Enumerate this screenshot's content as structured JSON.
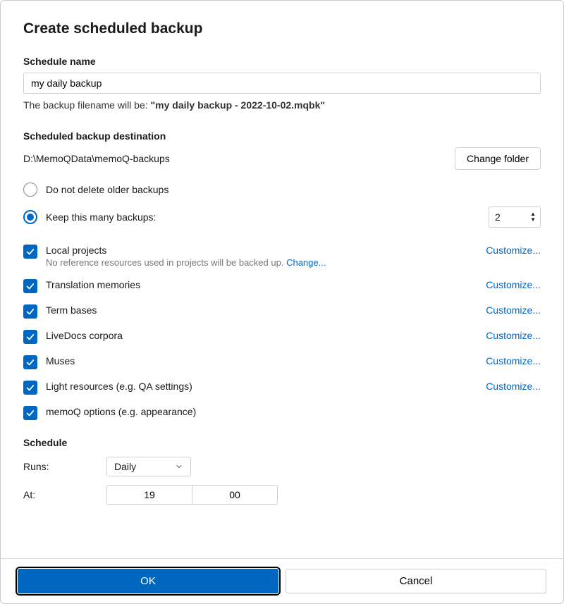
{
  "title": "Create scheduled backup",
  "schedule_name": {
    "label": "Schedule name",
    "value": "my daily backup"
  },
  "filename_hint": {
    "prefix": "The backup filename will be: ",
    "value": "\"my daily backup - 2022-10-02.mqbk\""
  },
  "destination": {
    "label": "Scheduled backup destination",
    "path": "D:\\MemoQData\\memoQ-backups",
    "change_button": "Change folder"
  },
  "retention": {
    "no_delete_label": "Do not delete older backups",
    "keep_many_label": "Keep this many backups:",
    "selected": "keep_many",
    "count": "2"
  },
  "items": [
    {
      "label": "Local projects",
      "sub_prefix": "No reference resources used in projects will be backed up. ",
      "sub_link": "Change...",
      "customize": "Customize..."
    },
    {
      "label": "Translation memories",
      "customize": "Customize..."
    },
    {
      "label": "Term bases",
      "customize": "Customize..."
    },
    {
      "label": "LiveDocs corpora",
      "customize": "Customize..."
    },
    {
      "label": "Muses",
      "customize": "Customize..."
    },
    {
      "label": "Light resources (e.g. QA settings)",
      "customize": "Customize..."
    },
    {
      "label": "memoQ options (e.g. appearance)"
    }
  ],
  "schedule": {
    "heading": "Schedule",
    "runs_label": "Runs:",
    "runs_value": "Daily",
    "at_label": "At:",
    "hours": "19",
    "minutes": "00"
  },
  "footer": {
    "ok": "OK",
    "cancel": "Cancel"
  }
}
